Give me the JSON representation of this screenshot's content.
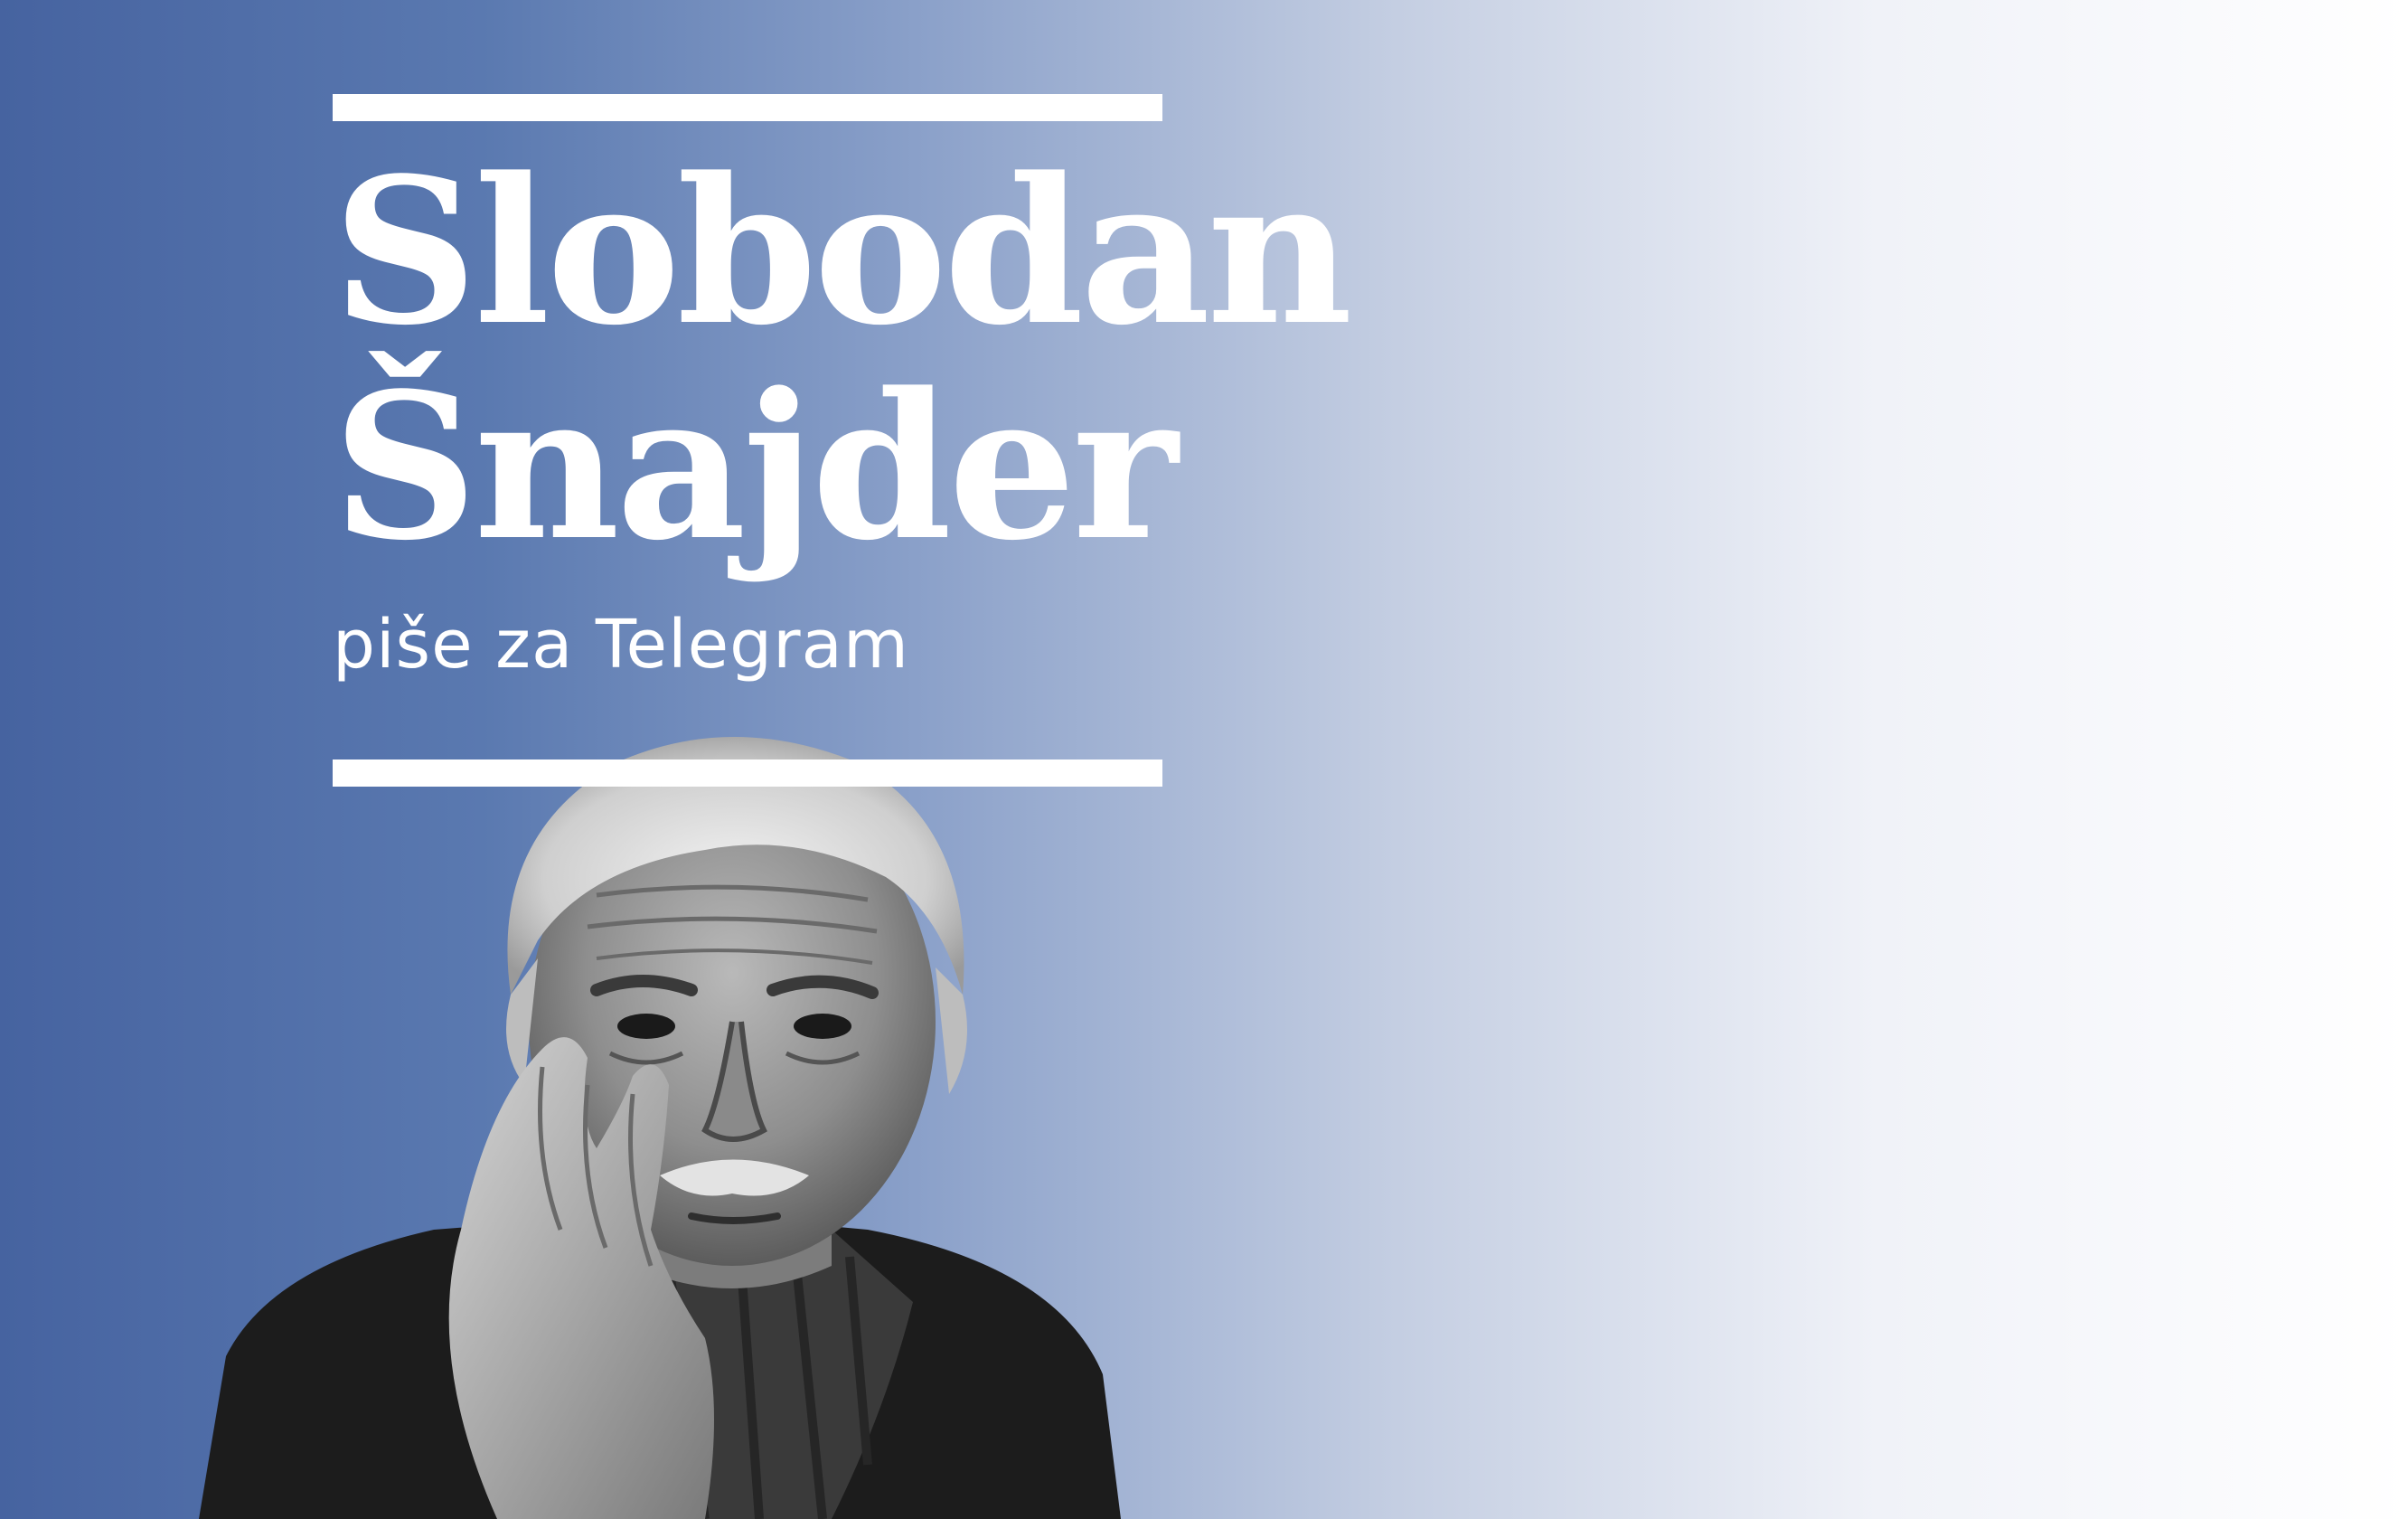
{
  "banner": {
    "author_first_name": "Slobodan",
    "author_last_name": "Šnajder",
    "tagline": "piše za Telegram",
    "colors": {
      "gradient_start": "#4663a0",
      "gradient_end": "#ffffff",
      "text": "#ffffff"
    },
    "portrait": {
      "icon": "author-portrait-photo",
      "style": "black-and-white"
    }
  }
}
